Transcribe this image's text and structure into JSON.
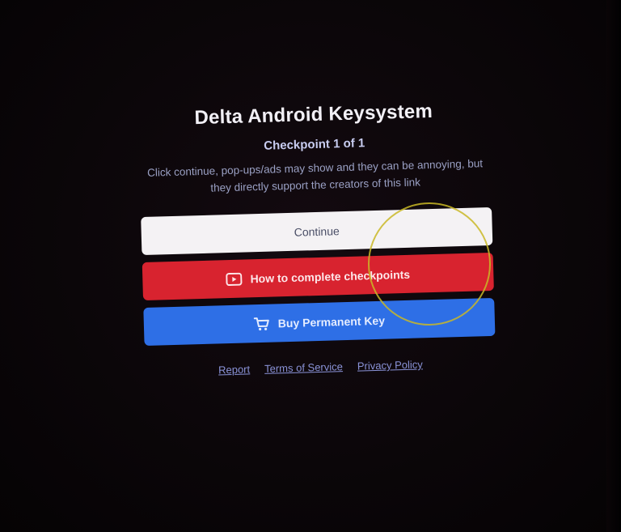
{
  "page": {
    "title": "Delta Android Keysystem",
    "subtitle": "Checkpoint 1 of 1",
    "description": "Click continue, pop-ups/ads may show and they can be annoying, but they directly support the creators of this link"
  },
  "buttons": {
    "continue_label": "Continue",
    "howto_label": "How to complete checkpoints",
    "howto_icon": "youtube-icon",
    "buy_label": "Buy Permanent Key",
    "buy_icon": "cart-icon"
  },
  "links": {
    "report": "Report",
    "terms": "Terms of Service",
    "privacy": "Privacy Policy"
  },
  "colors": {
    "continue_bg": "#f4f2f4",
    "howto_bg": "#d8232f",
    "buy_bg": "#2e6fe6",
    "link": "#8a93d8",
    "background": "#0b0609"
  }
}
